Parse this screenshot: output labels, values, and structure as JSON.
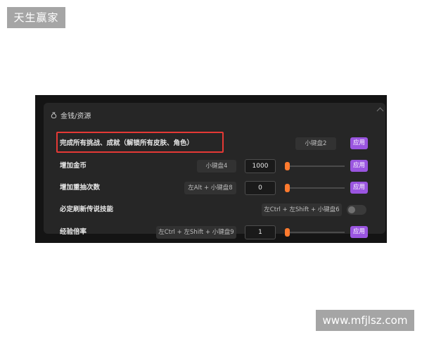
{
  "watermarks": {
    "top_left": "天生赢家",
    "bottom_right": "www.mfjlsz.com"
  },
  "section": {
    "title": "金钱/资源",
    "icon": "money-bag-icon"
  },
  "colors": {
    "apply_button": "#9a55e0",
    "slider_thumb": "#ff7a2e",
    "highlight_box": "#e53935"
  },
  "rows": [
    {
      "label": "完成所有挑战、成就（解锁所有皮肤、角色）",
      "hotkey": "小键盘2",
      "apply": "应用"
    },
    {
      "label": "增加金币",
      "hotkey": "小键盘4",
      "value": "1000",
      "slider": 0.0,
      "apply": "应用"
    },
    {
      "label": "增加重抽次数",
      "hotkey": "左Alt + 小键盘8",
      "value": "0",
      "slider": 0.0,
      "apply": "应用"
    },
    {
      "label": "必定刷新传说技能",
      "hotkey": "左Ctrl + 左Shift + 小键盘6",
      "toggle_on": false
    },
    {
      "label": "经验倍率",
      "hotkey": "左Ctrl + 左Shift + 小键盘9",
      "value": "1",
      "slider": 0.0,
      "apply": "应用"
    }
  ]
}
